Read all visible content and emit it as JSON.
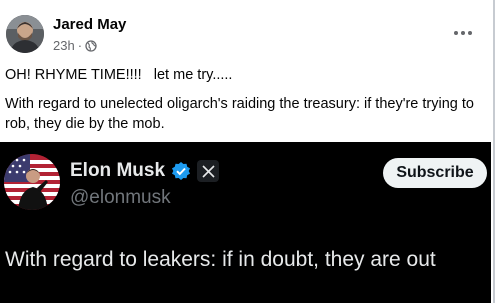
{
  "post": {
    "author": "Jared May",
    "time": "23h",
    "separator": "·",
    "audience_icon": "globe-icon",
    "text_line1": "OH! RHYME TIME!!!!   let me try.....",
    "text_line2": "With regard to unelected oligarch's raiding the treasury: if they're trying to rob, they die by the mob."
  },
  "tweet": {
    "name": "Elon Musk",
    "handle": "@elonmusk",
    "subscribe_label": "Subscribe",
    "text": "With regard to leakers: if in doubt, they are out",
    "verified_icon": "verified-badge-icon",
    "platform_icon": "x-logo-icon"
  },
  "colors": {
    "facebook_bg": "#ffffff",
    "tweet_bg": "#000000",
    "verified_blue": "#1d9bf0",
    "muted": "#65676b"
  }
}
